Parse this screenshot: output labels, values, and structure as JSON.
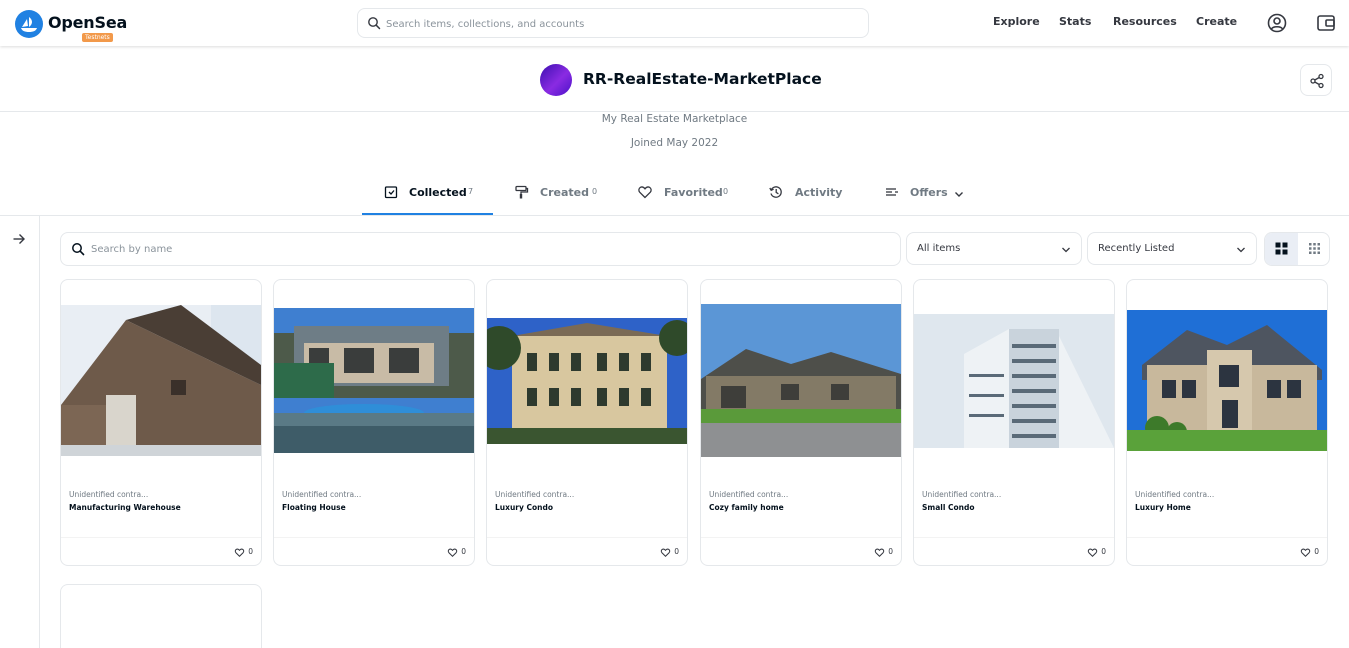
{
  "nav": {
    "brand": "OpenSea",
    "badge": "Testnets",
    "search_placeholder": "Search items, collections, and accounts",
    "links": [
      "Explore",
      "Stats",
      "Resources",
      "Create"
    ]
  },
  "profile": {
    "name": "RR-RealEstate-MarketPlace",
    "bio": "My Real Estate Marketplace",
    "joined": "Joined May 2022"
  },
  "tabs": [
    {
      "label": "Collected",
      "count": "7"
    },
    {
      "label": "Created",
      "count": "0"
    },
    {
      "label": "Favorited",
      "count": "0"
    },
    {
      "label": "Activity",
      "count": ""
    },
    {
      "label": "Offers",
      "count": ""
    }
  ],
  "filters": {
    "search_placeholder": "Search by name",
    "items_select": "All items",
    "sort_select": "Recently Listed"
  },
  "items": [
    {
      "collection": "Unidentified contra...",
      "title": "Manufacturing Warehouse",
      "likes": "0"
    },
    {
      "collection": "Unidentified contra...",
      "title": "Floating House",
      "likes": "0"
    },
    {
      "collection": "Unidentified contra...",
      "title": "Luxury Condo",
      "likes": "0"
    },
    {
      "collection": "Unidentified contra...",
      "title": "Cozy family home",
      "likes": "0"
    },
    {
      "collection": "Unidentified contra...",
      "title": "Small Condo",
      "likes": "0"
    },
    {
      "collection": "Unidentified contra...",
      "title": "Luxury Home",
      "likes": "0"
    }
  ],
  "colors": {
    "accent": "#2081e2",
    "badge": "#f2994a",
    "text_primary": "#04111d",
    "text_secondary": "#707a83",
    "border": "#e5e8eb"
  },
  "icons": [
    "search-icon",
    "profile-icon",
    "wallet-icon",
    "share-icon",
    "collected-icon",
    "created-icon",
    "heart-icon",
    "activity-icon",
    "offers-icon",
    "chevron-down-icon",
    "arrow-right-icon",
    "grid-large-icon",
    "grid-small-icon"
  ]
}
